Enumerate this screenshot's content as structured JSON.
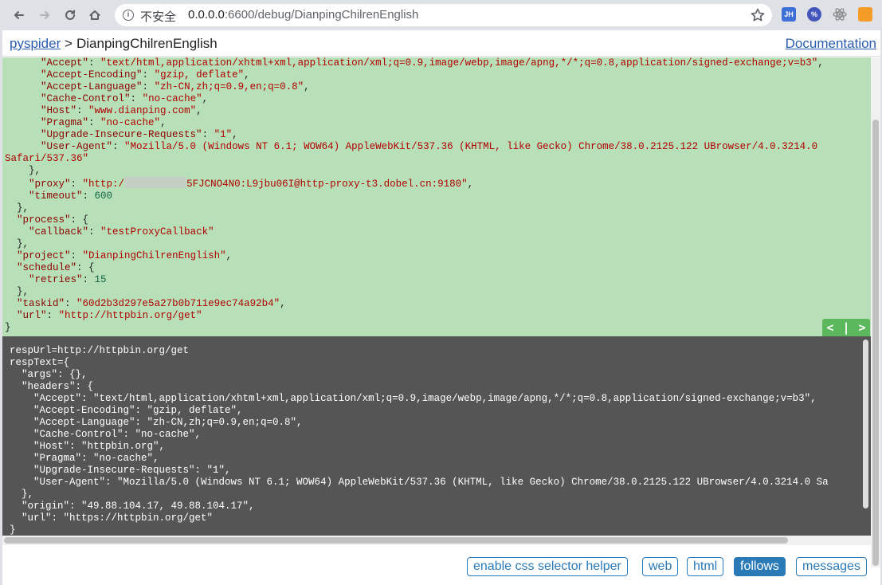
{
  "browser": {
    "security_label": "不安全",
    "url_host": "0.0.0.0",
    "url_rest": ":6600/debug/DianpingChilrenEnglish",
    "extensions": [
      {
        "label": "JH",
        "color": "#3f6fd8"
      },
      {
        "label": "%",
        "color": "#4455bb"
      },
      {
        "label": "",
        "color": "#8a8a8a"
      },
      {
        "label": "",
        "color": "#f59b28"
      }
    ]
  },
  "header": {
    "brand": "pyspider",
    "separator": ">",
    "project": "DianpingChilrenEnglish",
    "documentation": "Documentation"
  },
  "task": {
    "headers": [
      {
        "key": "\"Accept\"",
        "value": "\"text/html,application/xhtml+xml,application/xml;q=0.9,image/webp,image/apng,*/*;q=0.8,application/signed-exchange;v=b3\""
      },
      {
        "key": "\"Accept-Encoding\"",
        "value": "\"gzip, deflate\""
      },
      {
        "key": "\"Accept-Language\"",
        "value": "\"zh-CN,zh;q=0.9,en;q=0.8\""
      },
      {
        "key": "\"Cache-Control\"",
        "value": "\"no-cache\""
      },
      {
        "key": "\"Host\"",
        "value": "\"www.dianping.com\""
      },
      {
        "key": "\"Pragma\"",
        "value": "\"no-cache\""
      },
      {
        "key": "\"Upgrade-Insecure-Requests\"",
        "value": "\"1\""
      },
      {
        "key": "\"User-Agent\"",
        "value": "\"Mozilla/5.0 (Windows NT 6.1; WOW64) AppleWebKit/537.36 (KHTML, like Gecko) Chrome/38.0.2125.122 UBrowser/4.0.3214.0"
      }
    ],
    "user_agent_tail": "Safari/537.36\"",
    "proxy_key": "\"proxy\"",
    "proxy_prefix": "\"http:/",
    "proxy_suffix": "5FJCNO4N0:L9jbu06I@http-proxy-t3.dobel.cn:9180\"",
    "timeout_key": "\"timeout\"",
    "timeout_value": "600",
    "process_key": "\"process\"",
    "callback_key": "\"callback\"",
    "callback_value": "\"testProxyCallback\"",
    "project_key": "\"project\"",
    "project_value": "\"DianpingChilrenEnglish\"",
    "schedule_key": "\"schedule\"",
    "retries_key": "\"retries\"",
    "retries_value": "15",
    "taskid_key": "\"taskid\"",
    "taskid_value": "\"60d2b3d297e5a27b0b711e9ec74a92b4\"",
    "url_key": "\"url\"",
    "url_value": "\"http://httpbin.org/get\""
  },
  "pager": {
    "prev": "<",
    "sep": "|",
    "next": ">"
  },
  "result": {
    "lines": [
      "respUrl=http://httpbin.org/get",
      "respText={",
      "  \"args\": {},",
      "  \"headers\": {",
      "    \"Accept\": \"text/html,application/xhtml+xml,application/xml;q=0.9,image/webp,image/apng,*/*;q=0.8,application/signed-exchange;v=b3\",",
      "    \"Accept-Encoding\": \"gzip, deflate\",",
      "    \"Accept-Language\": \"zh-CN,zh;q=0.9,en;q=0.8\",",
      "    \"Cache-Control\": \"no-cache\",",
      "    \"Host\": \"httpbin.org\",",
      "    \"Pragma\": \"no-cache\",",
      "    \"Upgrade-Insecure-Requests\": \"1\",",
      "    \"User-Agent\": \"Mozilla/5.0 (Windows NT 6.1; WOW64) AppleWebKit/537.36 (KHTML, like Gecko) Chrome/38.0.2125.122 UBrowser/4.0.3214.0 Sa",
      "  },",
      "  \"origin\": \"49.88.104.17, 49.88.104.17\",",
      "  \"url\": \"https://httpbin.org/get\"",
      "}"
    ]
  },
  "footer": {
    "css_helper": "enable css selector helper",
    "web": "web",
    "html": "html",
    "follows": "follows",
    "messages": "messages"
  }
}
